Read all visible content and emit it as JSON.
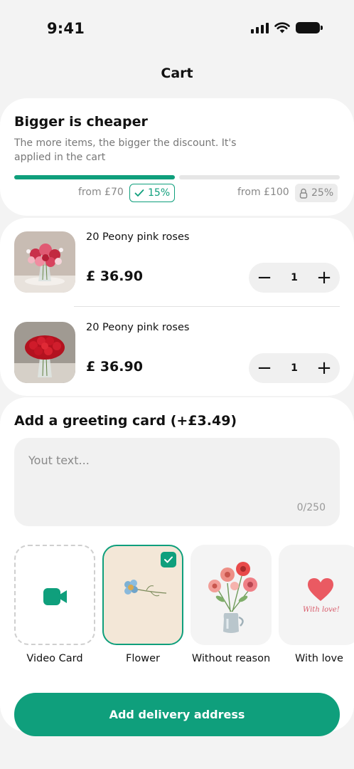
{
  "status_bar": {
    "time": "9:41"
  },
  "header": {
    "title": "Cart"
  },
  "promo": {
    "title": "Bigger is cheaper",
    "description": "The more items, the bigger the discount. It's applied in the cart",
    "tiers": [
      {
        "label": "from £70",
        "discount": "15%",
        "state": "achieved",
        "progress": 1.0
      },
      {
        "label": "from £100",
        "discount": "25%",
        "state": "locked",
        "progress": 0.0
      }
    ],
    "accent_color": "#0f9f7c"
  },
  "cart": {
    "items": [
      {
        "name": "20 Peony pink roses",
        "price": "£ 36.90",
        "quantity": "1",
        "decrease_symbol": "−",
        "increase_symbol": "+"
      },
      {
        "name": "20 Peony pink roses",
        "price": "£ 36.90",
        "quantity": "1",
        "decrease_symbol": "−",
        "increase_symbol": "+"
      }
    ]
  },
  "greeting": {
    "title": "Add a greeting card (+£3.49)",
    "placeholder": "Yout text...",
    "counter": "0/250",
    "cards": [
      {
        "label": "Video Card",
        "icon": "video-camera-icon",
        "selected": false
      },
      {
        "label": "Flower",
        "icon": "flower-sprig-icon",
        "selected": true
      },
      {
        "label": "Without reason",
        "icon": "flower-vase-icon",
        "selected": false
      },
      {
        "label": "With love",
        "icon": "heart-icon",
        "card_text": "With love!",
        "selected": false
      }
    ]
  },
  "cta": {
    "label": "Add delivery address"
  }
}
